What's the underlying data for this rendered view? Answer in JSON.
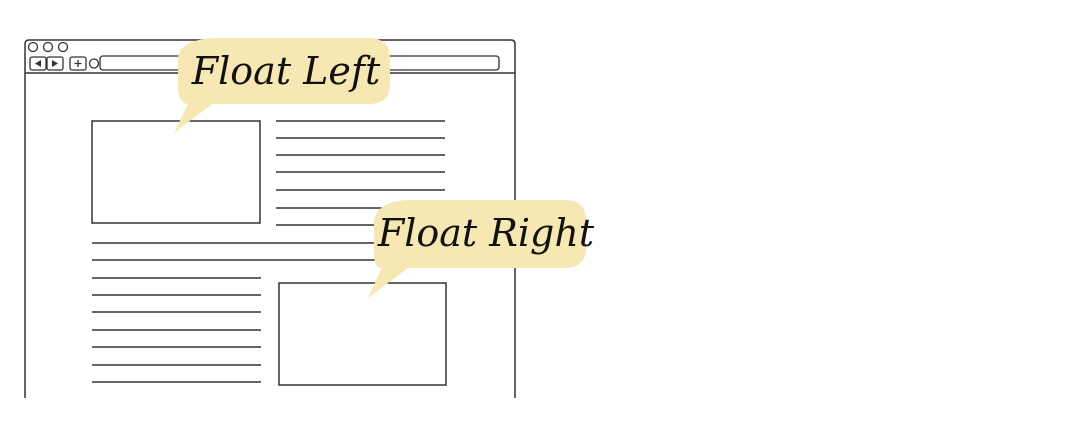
{
  "callouts": {
    "float_left": "Float Left",
    "float_right": "Float Right"
  },
  "colors": {
    "stroke": "#333333",
    "callout_fill": "#f6e7b3",
    "background": "#ffffff"
  },
  "icons": [
    "window-control-dot",
    "back-arrow-icon",
    "forward-arrow-icon",
    "plus-icon",
    "circle-icon"
  ]
}
